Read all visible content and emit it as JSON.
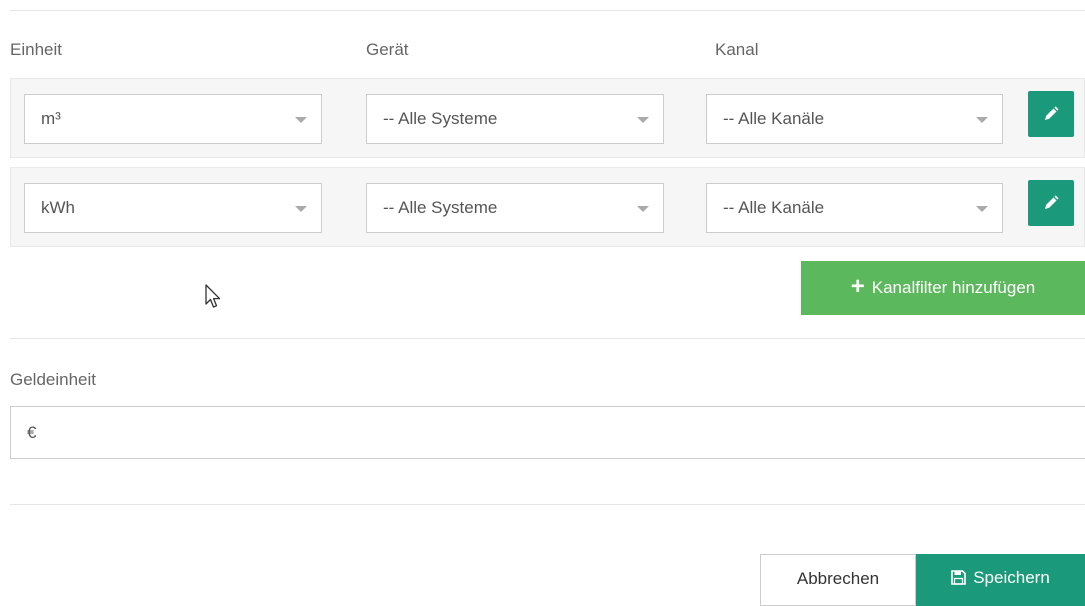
{
  "columns": {
    "unit": "Einheit",
    "device": "Gerät",
    "channel": "Kanal"
  },
  "filters": [
    {
      "unit": "m³",
      "device": "-- Alle Systeme",
      "channel": "-- Alle Kanäle"
    },
    {
      "unit": "kWh",
      "device": "-- Alle Systeme",
      "channel": "-- Alle Kanäle"
    }
  ],
  "icons": {
    "edit": "pencil-icon",
    "add": "plus-icon",
    "save": "floppy-disk-icon",
    "dropdown": "caret-down-icon"
  },
  "add_filter_label": "Kanalfilter hinzufügen",
  "currency": {
    "label": "Geldeinheit",
    "value": "€"
  },
  "footer": {
    "cancel_label": "Abbrechen",
    "save_label": "Speichern"
  },
  "colors": {
    "primary": "#1a9a7a",
    "success": "#5cb85c"
  }
}
